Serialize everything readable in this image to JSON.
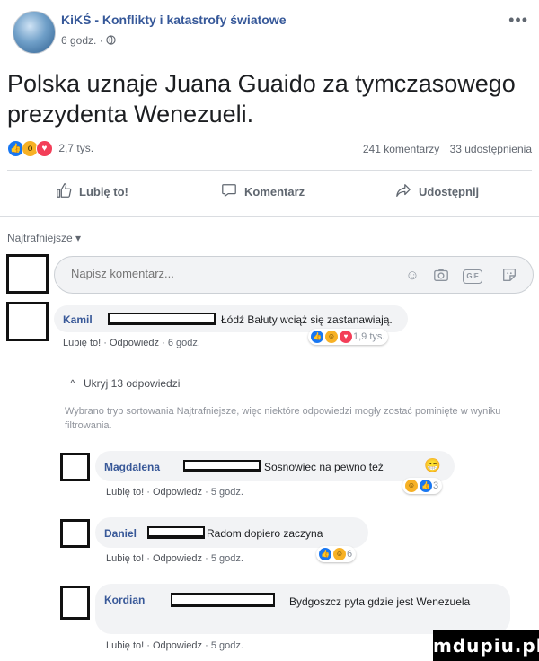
{
  "post": {
    "page_name": "KiKŚ - Konflikty i katastrofy światowe",
    "time": "6 godz. ·",
    "globe_icon": "globe-icon",
    "text": "Polska uznaje Juana Guaido za tymczasowego prezydenta Wenezueli.",
    "reaction_count": "2,7 tys.",
    "comments_count": "241 komentarzy",
    "shares_count": "33 udostępnienia"
  },
  "actions": {
    "like": "Lubię to!",
    "comment": "Komentarz",
    "share": "Udostępnij"
  },
  "sort_label": "Najtrafniejsze ▾",
  "composer": {
    "placeholder": "Napisz komentarz...",
    "icons": [
      "emoji-icon",
      "camera-icon",
      "gif-icon",
      "sticker-icon"
    ],
    "gif_label": "GIF"
  },
  "comments": [
    {
      "name": "Kamil",
      "text": "Łódź Bałuty wciąż się zastanawiają.",
      "like": "Lubię to!",
      "reply": "Odpowiedz",
      "time": "6 godz.",
      "reactions": "1,9 tys."
    },
    {
      "name": "Magdalena",
      "text": "Sosnowiec na pewno też",
      "like": "Lubię to!",
      "reply": "Odpowiedz",
      "time": "5 godz.",
      "reactions": "3"
    },
    {
      "name": "Daniel",
      "text": "Radom dopiero zaczyna",
      "like": "Lubię to!",
      "reply": "Odpowiedz",
      "time": "5 godz.",
      "reactions": "6"
    },
    {
      "name": "Kordian",
      "text": "Bydgoszcz pyta gdzie jest Wenezuela",
      "like": "Lubię to!",
      "reply": "Odpowiedz",
      "time": "5 godz.",
      "reactions": ""
    }
  ],
  "hidden_replies": "Ukryj 13 odpowiedzi",
  "notice": "Wybrano tryb sortowania Najtrafniejsze, więc niektóre odpowiedzi mogły zostać pominięte w wyniku filtrowania.",
  "watermark": "mdupiu.pl",
  "colors": {
    "link": "#385898",
    "like": "#1877f2",
    "love": "#f33e58",
    "wow": "#f7b125"
  }
}
